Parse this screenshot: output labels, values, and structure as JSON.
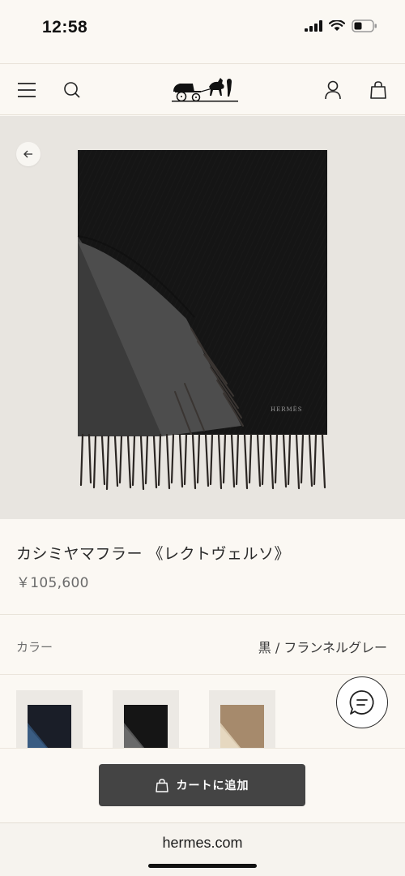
{
  "status_bar": {
    "time": "12:58"
  },
  "nav": {
    "menu_icon": "hamburger-menu-icon",
    "search_icon": "search-icon",
    "logo_icon": "carriage-logo-icon",
    "account_icon": "user-icon",
    "bag_icon": "shopping-bag-icon"
  },
  "hero": {
    "back_icon": "arrow-left-icon",
    "scarf_brand_label": "HERMÈS",
    "colors": {
      "bg": "#e8e5e0",
      "scarf_black": "#141414",
      "scarf_grey": "#4a4a4a"
    }
  },
  "product": {
    "title": "カシミヤマフラー 《レクトヴェルソ》",
    "price": "￥105,600"
  },
  "color": {
    "label": "カラー",
    "value": "黒 / フランネルグレー"
  },
  "swatches": [
    {
      "name": "navy-blue"
    },
    {
      "name": "black-grey",
      "selected": true
    },
    {
      "name": "camel-beige"
    }
  ],
  "chat": {
    "icon": "chat-bubble-icon"
  },
  "cart": {
    "label": "カートに追加",
    "icon": "shopping-bag-icon"
  },
  "browser": {
    "url": "hermes.com"
  }
}
